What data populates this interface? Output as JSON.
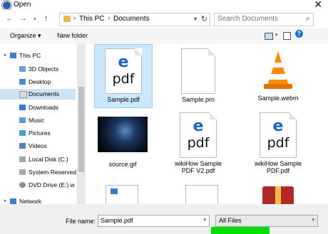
{
  "window": {
    "title": "Open"
  },
  "address": {
    "segments": [
      "This PC",
      "Documents"
    ],
    "search_placeholder": "Search Documents"
  },
  "toolbar": {
    "organize": "Organize ▾",
    "new_folder": "New folder"
  },
  "sidebar": {
    "items": [
      {
        "label": "This PC"
      },
      {
        "label": "3D Objects"
      },
      {
        "label": "Desktop"
      },
      {
        "label": "Documents"
      },
      {
        "label": "Downloads"
      },
      {
        "label": "Music"
      },
      {
        "label": "Pictures"
      },
      {
        "label": "Videos"
      },
      {
        "label": "Local Disk (C:)"
      },
      {
        "label": "System Reserved"
      },
      {
        "label": "DVD Drive (E:) w"
      },
      {
        "label": "Network"
      }
    ]
  },
  "files": [
    {
      "name": "Sample.pdf",
      "icon": "pdf-icon"
    },
    {
      "name": "Sample.prn",
      "icon": "blank-document-icon"
    },
    {
      "name": "Sample.webm",
      "icon": "vlc-cone-icon"
    },
    {
      "name": "source.gif",
      "icon": "image-thumbnail"
    },
    {
      "name": "wikiHow Sample PDF V2.pdf",
      "icon": "pdf-icon"
    },
    {
      "name": "wikiHow Sample PDF.pdf",
      "icon": "pdf-icon"
    }
  ],
  "bottom": {
    "file_name_label": "File name:",
    "file_name_value": "Sample.pdf",
    "file_type_value": "All Files"
  },
  "colors": {
    "accent": "#1e63c6",
    "selection": "#cce2f5",
    "highlight": "#00e000"
  }
}
